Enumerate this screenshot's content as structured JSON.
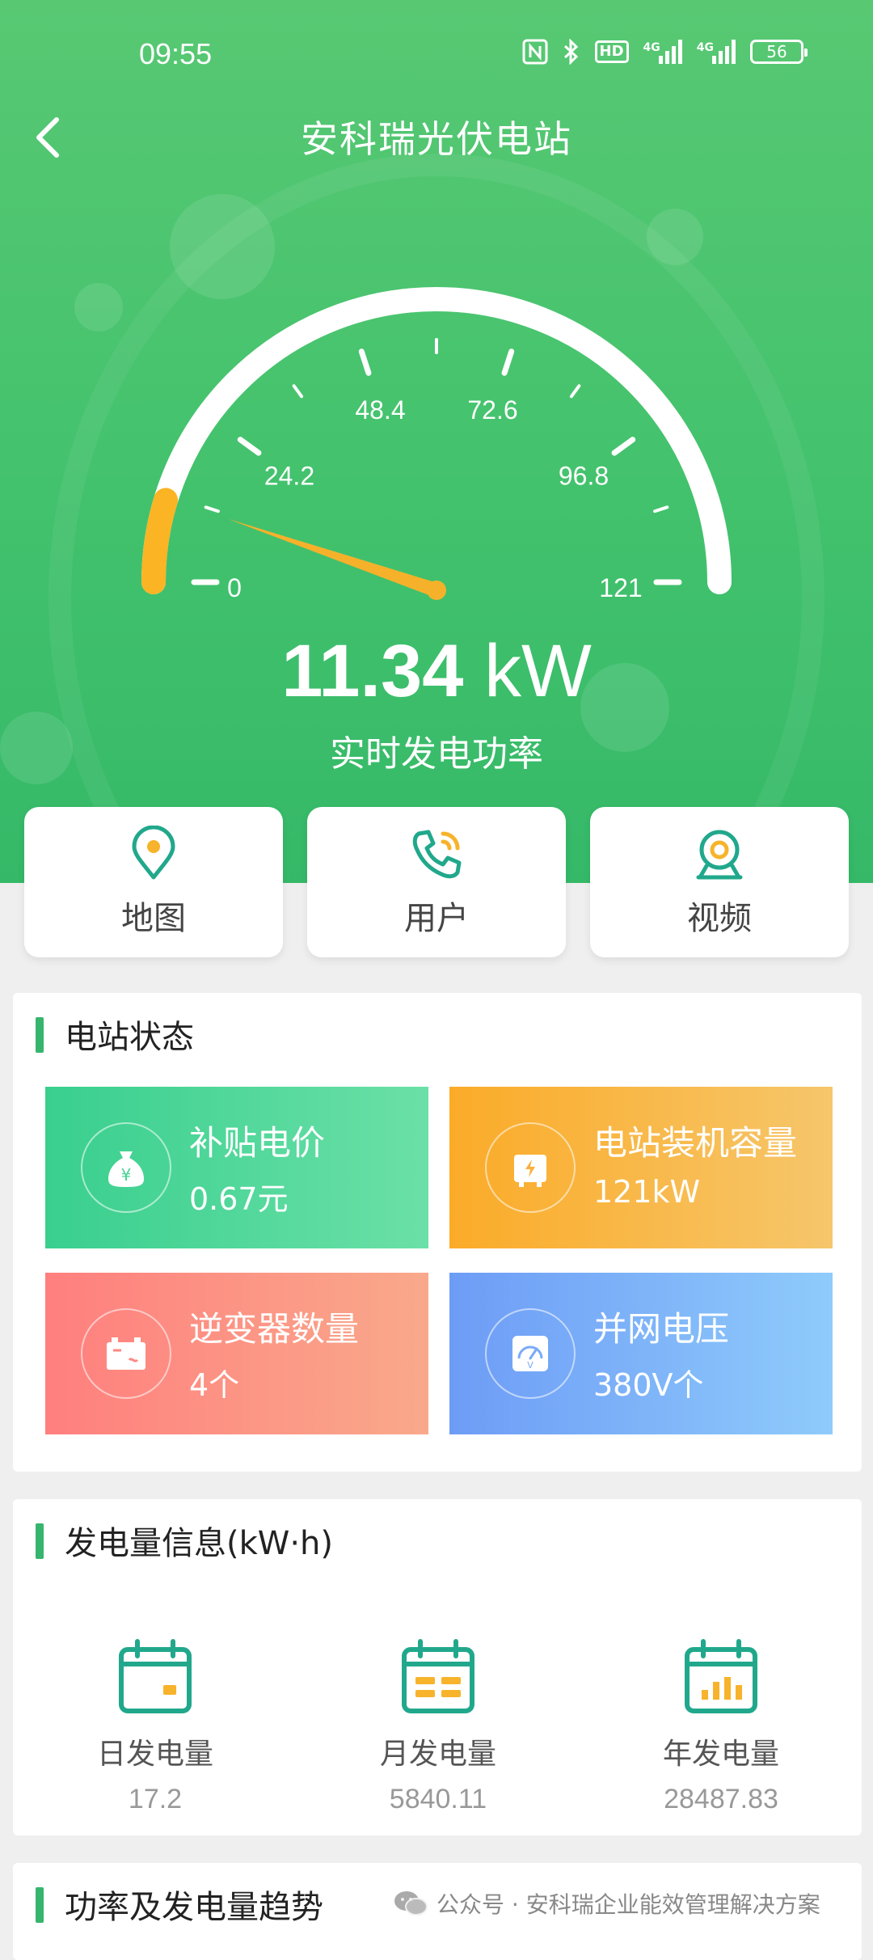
{
  "status_bar": {
    "time": "09:55",
    "hd_label": "HD",
    "network_label": "4G",
    "battery": "56"
  },
  "header": {
    "title": "安科瑞光伏电站"
  },
  "gauge": {
    "min": 0,
    "max": 121,
    "current": 11.34,
    "ticks": [
      "0",
      "24.2",
      "48.4",
      "72.6",
      "96.8",
      "121"
    ],
    "value_text": "11.34",
    "unit_text": "kW",
    "label": "实时发电功率",
    "accent_color": "#fbb424",
    "needle_color": "#f6b12b"
  },
  "quick_actions": [
    {
      "label": "地图",
      "icon": "map-pin-icon"
    },
    {
      "label": "用户",
      "icon": "phone-icon"
    },
    {
      "label": "视频",
      "icon": "camera-icon"
    }
  ],
  "station_status": {
    "title": "电站状态",
    "tiles": [
      {
        "label": "补贴电价",
        "value": "0.67元",
        "icon": "money-bag-icon"
      },
      {
        "label": "电站装机容量",
        "value": "121kW",
        "icon": "battery-icon"
      },
      {
        "label": "逆变器数量",
        "value": "4个",
        "icon": "inverter-icon"
      },
      {
        "label": "并网电压",
        "value": "380V个",
        "icon": "voltmeter-icon"
      }
    ]
  },
  "energy_info": {
    "title": "发电量信息(kW·h)",
    "items": [
      {
        "label": "日发电量",
        "value": "17.2",
        "icon": "calendar-day-icon"
      },
      {
        "label": "月发电量",
        "value": "5840.11",
        "icon": "calendar-month-icon"
      },
      {
        "label": "年发电量",
        "value": "28487.83",
        "icon": "calendar-year-icon"
      }
    ]
  },
  "trend": {
    "title": "功率及发电量趋势"
  },
  "watermark": {
    "text": "公众号 · 安科瑞企业能效管理解决方案"
  }
}
